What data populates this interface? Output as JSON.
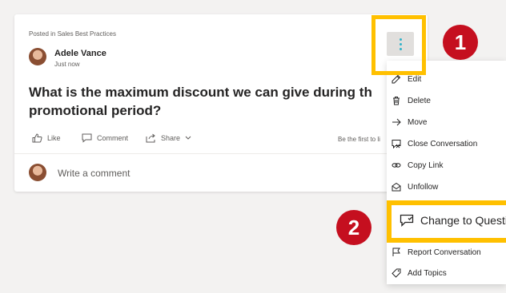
{
  "post": {
    "posted_in": "Posted in Sales Best Practices",
    "author": "Adele Vance",
    "time": "Just now",
    "title_line1": "What is the maximum discount we can give during th",
    "title_line2": "promotional period?",
    "actions": {
      "like": "Like",
      "comment": "Comment",
      "share": "Share"
    },
    "first_to_like": "Be the first to li",
    "comment_placeholder": "Write a comment"
  },
  "menu": {
    "items": [
      {
        "label": "Edit",
        "icon": "pencil-icon"
      },
      {
        "label": "Delete",
        "icon": "trash-icon"
      },
      {
        "label": "Move",
        "icon": "arrow-right-icon"
      },
      {
        "label": "Close Conversation",
        "icon": "close-conversation-icon"
      },
      {
        "label": "Copy Link",
        "icon": "link-icon"
      },
      {
        "label": "Unfollow",
        "icon": "unfollow-icon"
      },
      {
        "label": "Change to Questi",
        "icon": "question-chat-icon"
      },
      {
        "label": "Report Conversation",
        "icon": "flag-icon"
      },
      {
        "label": "Add Topics",
        "icon": "tag-icon"
      }
    ]
  },
  "callouts": {
    "step1": "1",
    "step2": "2"
  },
  "colors": {
    "highlight": "#ffc000",
    "badge": "#c50f1f",
    "more_dots": "#2fb3c9"
  }
}
